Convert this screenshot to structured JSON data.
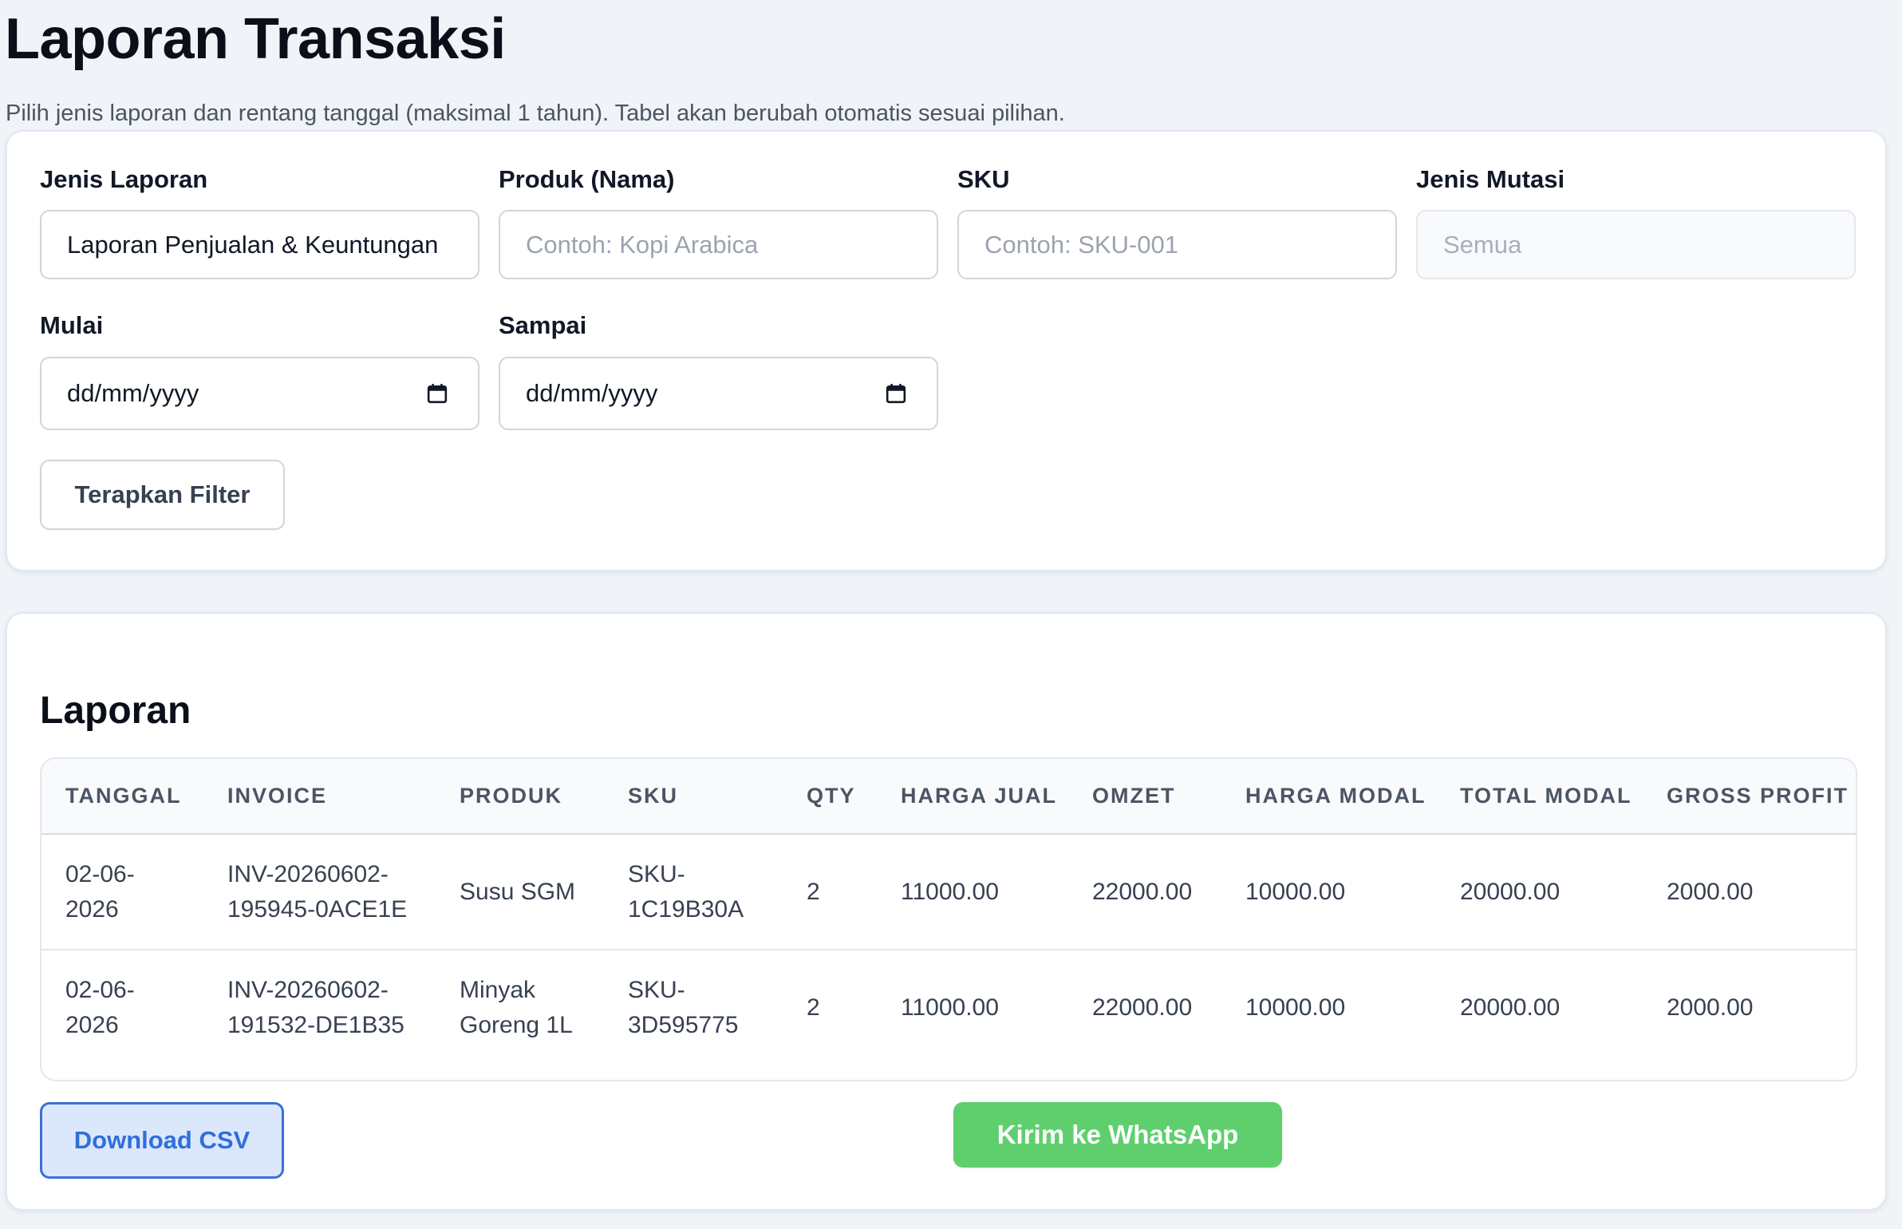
{
  "page": {
    "title": "Laporan Transaksi",
    "subtitle": "Pilih jenis laporan dan rentang tanggal (maksimal 1 tahun). Tabel akan berubah otomatis sesuai pilihan."
  },
  "filters": {
    "report_type": {
      "label": "Jenis Laporan",
      "value": "Laporan Penjualan & Keuntungan"
    },
    "product": {
      "label": "Produk (Nama)",
      "placeholder": "Contoh: Kopi Arabica"
    },
    "sku": {
      "label": "SKU",
      "placeholder": "Contoh: SKU-001"
    },
    "mutation": {
      "label": "Jenis Mutasi",
      "value": "Semua"
    },
    "start": {
      "label": "Mulai",
      "value": "dd/mm/yyyy"
    },
    "end": {
      "label": "Sampai",
      "value": "dd/mm/yyyy"
    },
    "apply_label": "Terapkan Filter"
  },
  "report": {
    "title": "Laporan",
    "columns": [
      "TANGGAL",
      "INVOICE",
      "PRODUK",
      "SKU",
      "QTY",
      "HARGA JUAL",
      "OMZET",
      "HARGA MODAL",
      "TOTAL MODAL",
      "GROSS PROFIT"
    ],
    "rows": [
      {
        "date": [
          "02-06-",
          "2026"
        ],
        "invoice": [
          "INV-20260602-",
          "195945-0ACE1E"
        ],
        "product": [
          "Susu SGM"
        ],
        "sku": [
          "SKU-",
          "1C19B30A"
        ],
        "qty": "2",
        "price": "11000.00",
        "omzet": "22000.00",
        "cost": "10000.00",
        "total_cost": "20000.00",
        "gross_profit": "2000.00"
      },
      {
        "date": [
          "02-06-",
          "2026"
        ],
        "invoice": [
          "INV-20260602-",
          "191532-DE1B35"
        ],
        "product": [
          "Minyak",
          "Goreng 1L"
        ],
        "sku": [
          "SKU-",
          "3D595775"
        ],
        "qty": "2",
        "price": "11000.00",
        "omzet": "22000.00",
        "cost": "10000.00",
        "total_cost": "20000.00",
        "gross_profit": "2000.00"
      }
    ],
    "download_label": "Download CSV",
    "whatsapp_label": "Kirim ke WhatsApp"
  },
  "icons": {
    "date_picker": "calendar-icon"
  },
  "colors": {
    "primary_button": "#2f6fdc",
    "whatsapp_button": "#5fcf6e"
  }
}
